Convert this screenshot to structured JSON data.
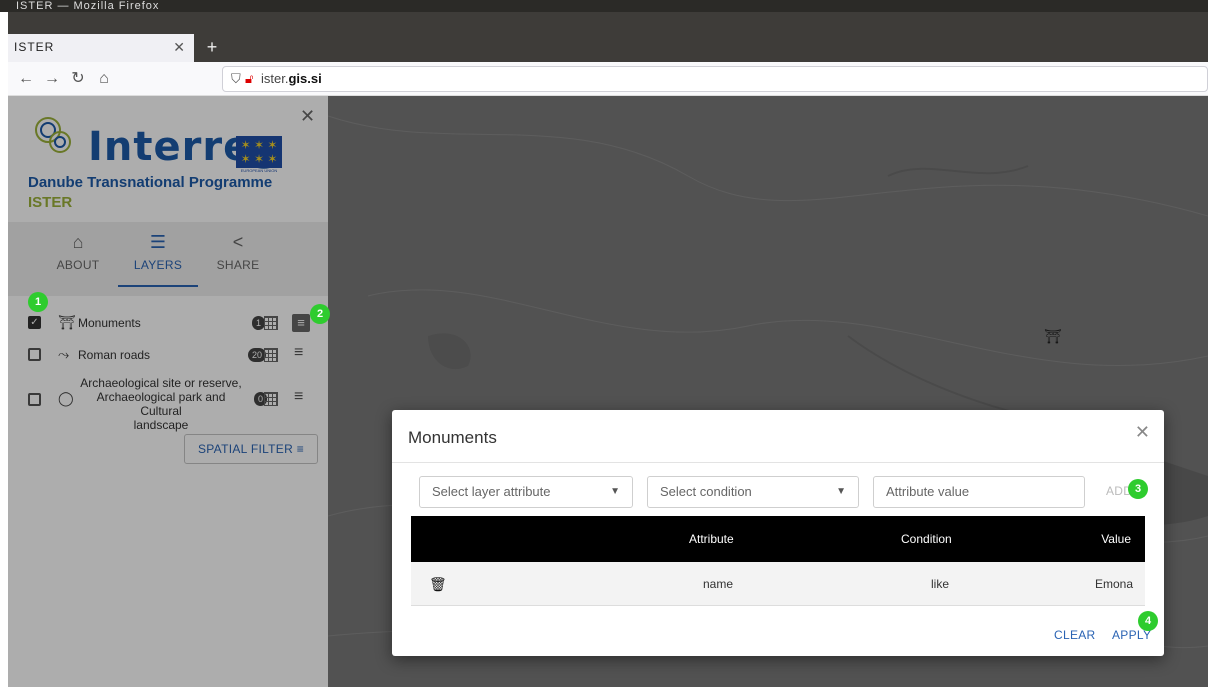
{
  "browser": {
    "window_title": "ISTER — Mozilla Firefox",
    "tab_title": "ISTER",
    "url_prefix": "ister.",
    "url_domain": "gis.si"
  },
  "sidebar": {
    "logo_text": "Interreg",
    "eu_caption": "EUROPEAN UNION",
    "program_name": "Danube Transnational Programme",
    "program_sub": "ISTER",
    "nav": [
      {
        "label": "ABOUT",
        "icon": "home-icon"
      },
      {
        "label": "LAYERS",
        "icon": "list-icon",
        "active": true
      },
      {
        "label": "SHARE",
        "icon": "share-icon"
      }
    ],
    "layers": [
      {
        "label": "Monuments",
        "checked": true,
        "count": "1",
        "icon": "monument-icon"
      },
      {
        "label": "Roman roads",
        "checked": false,
        "count": "20",
        "icon": "road-icon"
      },
      {
        "label": "Archaeological site or reserve, Archaeological park and Cultural landscape",
        "label_lines": [
          "Archaeological site or reserve,",
          "Archaeological park and Cultural",
          "landscape"
        ],
        "checked": false,
        "count": "0",
        "icon": "site-icon"
      }
    ],
    "spatial_filter_label": "SPATIAL FILTER"
  },
  "badges": [
    "1",
    "2",
    "3",
    "4"
  ],
  "modal": {
    "title": "Monuments",
    "attribute_placeholder": "Select layer attribute",
    "condition_placeholder": "Select condition",
    "value_placeholder": "Attribute value",
    "add_label": "ADD",
    "table": {
      "headers": [
        "Attribute",
        "Condition",
        "Value"
      ],
      "rows": [
        {
          "attribute": "name",
          "condition": "like",
          "value": "Emona"
        }
      ]
    },
    "clear_label": "CLEAR",
    "apply_label": "APPLY"
  },
  "colors": {
    "accent": "#2a63b3",
    "badge": "#2ecc2e",
    "interreg_blue": "#1d5aa8",
    "ister_green": "#9bb13a"
  }
}
